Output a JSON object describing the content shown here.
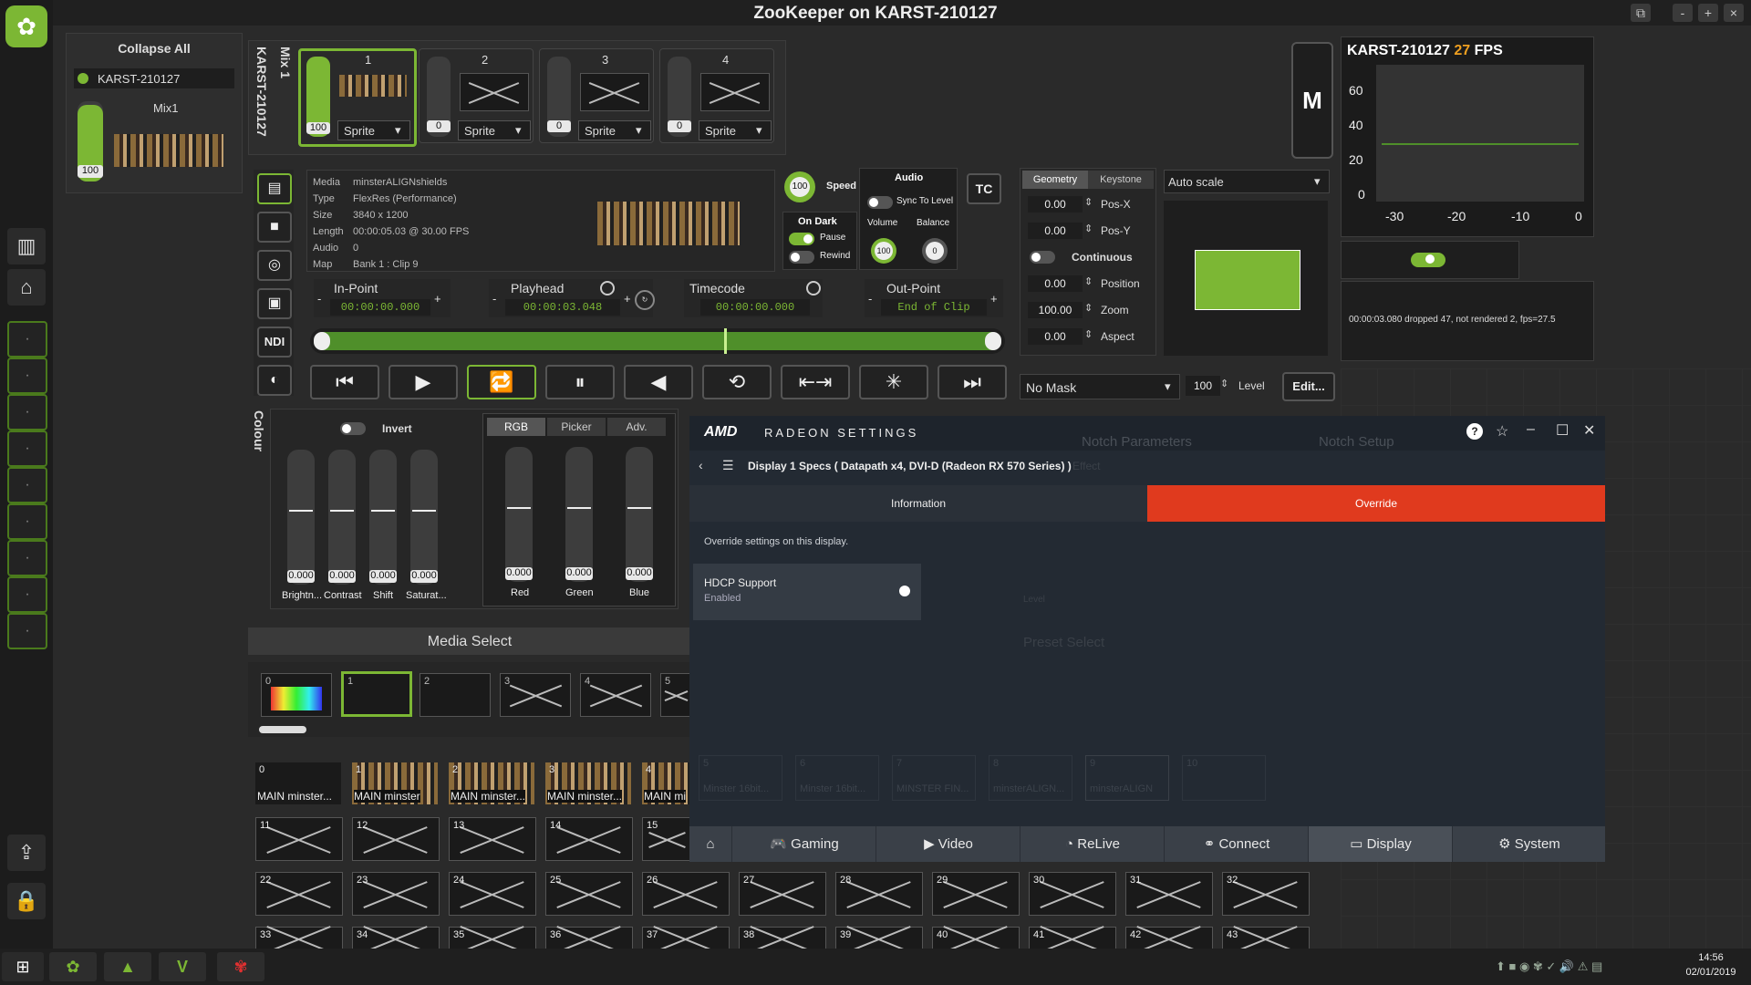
{
  "window": {
    "title": "ZooKeeper on KARST-210127",
    "btn_min": "-",
    "btn_max": "+",
    "btn_close": "×"
  },
  "left_panel": {
    "collapse_all": "Collapse All",
    "machine": "KARST-210127",
    "mix_name": "Mix1",
    "mix_level": "100"
  },
  "mix_strip": {
    "vertical_machine": "KARST-210127",
    "vertical_mix": "Mix 1",
    "layers": [
      {
        "num": "1",
        "level": "100",
        "blend": "Sprite"
      },
      {
        "num": "2",
        "level": "0",
        "blend": "Sprite"
      },
      {
        "num": "3",
        "level": "0",
        "blend": "Sprite"
      },
      {
        "num": "4",
        "level": "0",
        "blend": "Sprite"
      }
    ],
    "m_button": "M"
  },
  "fps_panel": {
    "machine": "KARST-210127",
    "fps_value": "27",
    "fps_unit": "FPS",
    "y_ticks": [
      "60",
      "40",
      "20",
      "0"
    ],
    "x_ticks": [
      "-30",
      "-20",
      "-10",
      "0"
    ],
    "status": "00:00:03.080 dropped 47, not rendered 2, fps=27.5"
  },
  "media_info": {
    "rows": [
      {
        "k": "Media",
        "v": "minsterALIGNshields"
      },
      {
        "k": "Type",
        "v": "FlexRes (Performance)"
      },
      {
        "k": "Size",
        "v": "3840 x 1200"
      },
      {
        "k": "Length",
        "v": "00:00:05.03 @ 30.00 FPS"
      },
      {
        "k": "Audio",
        "v": "0"
      },
      {
        "k": "Map",
        "v": "Bank 1 : Clip 9"
      }
    ]
  },
  "side_icons": {
    "ndi": "NDI"
  },
  "speed": {
    "value": "100",
    "label": "Speed"
  },
  "on_dark": {
    "title": "On Dark",
    "pause": "Pause",
    "rewind": "Rewind"
  },
  "audio": {
    "title": "Audio",
    "sync": "Sync To Level",
    "volume_label": "Volume",
    "balance_label": "Balance",
    "volume": "100",
    "balance": "0"
  },
  "tc_button": "TC",
  "timing": {
    "in_point": {
      "label": "In-Point",
      "value": "00:00:00.000"
    },
    "playhead": {
      "label": "Playhead",
      "value": "00:00:03.048"
    },
    "timecode": {
      "label": "Timecode",
      "value": "00:00:00.000"
    },
    "out_point": {
      "label": "Out-Point",
      "value": "End of Clip"
    },
    "minus": "-",
    "plus": "+"
  },
  "transport": [
    "⏮",
    "▶",
    "🔁",
    "⏸",
    "◀",
    "⟲",
    "⇤⇥",
    "✳",
    "⏭"
  ],
  "geometry": {
    "tabs": [
      "Geometry",
      "Keystone"
    ],
    "rows": [
      {
        "value": "0.00",
        "label": "Pos-X"
      },
      {
        "value": "0.00",
        "label": "Pos-Y"
      },
      {
        "value": "",
        "label": "Continuous"
      },
      {
        "value": "0.00",
        "label": "Position"
      },
      {
        "value": "100.00",
        "label": "Zoom"
      },
      {
        "value": "0.00",
        "label": "Aspect"
      }
    ],
    "scale_select": "Auto scale"
  },
  "mask": {
    "select": "No Mask",
    "level": "100",
    "level_label": "Level",
    "edit": "Edit..."
  },
  "colour": {
    "vertical_label": "Colour",
    "invert": "Invert",
    "sliders": [
      {
        "label": "Brightn...",
        "value": "0.000"
      },
      {
        "label": "Contrast",
        "value": "0.000"
      },
      {
        "label": "Shift",
        "value": "0.000"
      },
      {
        "label": "Saturat...",
        "value": "0.000"
      }
    ],
    "tabs": [
      "RGB",
      "Picker",
      "Adv."
    ],
    "rgb": [
      {
        "label": "Red",
        "value": "0.000"
      },
      {
        "label": "Green",
        "value": "0.000"
      },
      {
        "label": "Blue",
        "value": "0.000"
      }
    ]
  },
  "media_select": {
    "title": "Media Select",
    "banks": [
      "0",
      "1",
      "2",
      "3",
      "4",
      "5"
    ],
    "clips_row1": [
      {
        "num": "0",
        "name": "MAIN minster..."
      },
      {
        "num": "1",
        "name": "MAIN minster"
      },
      {
        "num": "2",
        "name": "MAIN minster..."
      },
      {
        "num": "3",
        "name": "MAIN minster..."
      },
      {
        "num": "4",
        "name": "MAIN mi"
      }
    ],
    "clips_row2": [
      "11",
      "12",
      "13",
      "14",
      "15"
    ],
    "clips_row3": [
      "22",
      "23",
      "24",
      "25",
      "26",
      "27",
      "28",
      "29",
      "30",
      "31",
      "32"
    ],
    "clips_row4": [
      "33",
      "34",
      "35",
      "36",
      "37",
      "38",
      "39",
      "40",
      "41",
      "42",
      "43"
    ]
  },
  "amd": {
    "brand": "AMD",
    "app_title": "RADEON SETTINGS",
    "breadcrumb": "Display 1 Specs ( Datapath x4, DVI-D (Radeon RX 570 Series) )",
    "tab_info": "Information",
    "tab_override": "Override",
    "desc": "Override settings on this display.",
    "hdcp_label": "HDCP Support",
    "hdcp_state": "Enabled",
    "bg_notch_params": "Notch Parameters",
    "bg_notch_setup": "Notch Setup",
    "bg_effect": "Effect",
    "bg_level": "Level",
    "bg_preset": "Preset Select",
    "bg_clips": [
      {
        "num": "5",
        "name": "Minster 16bit..."
      },
      {
        "num": "6",
        "name": "Minster 16bit..."
      },
      {
        "num": "7",
        "name": "MINSTER FIN..."
      },
      {
        "num": "8",
        "name": "minsterALIGN..."
      },
      {
        "num": "9",
        "name": "minsterALIGN"
      },
      {
        "num": "10",
        "name": ""
      }
    ],
    "nav": [
      "Gaming",
      "Video",
      "ReLive",
      "Connect",
      "Display",
      "System"
    ],
    "accent": "#e03a1e"
  },
  "taskbar": {
    "time": "14:56",
    "date": "02/01/2019"
  }
}
